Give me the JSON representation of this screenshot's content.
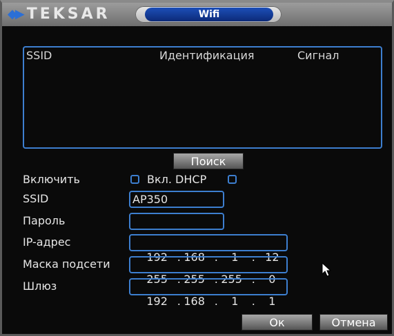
{
  "header": {
    "logo_text": "TEKSAR",
    "logo_symbol": "◆▶",
    "tab_title": "Wifi"
  },
  "network_list": {
    "columns": [
      "SSID",
      "Идентификация",
      "Сигнал"
    ],
    "rows": []
  },
  "search_button": "Поиск",
  "form": {
    "enable_label": "Включить",
    "dhcp_label": "Вкл. DHCP",
    "enable_checked": false,
    "dhcp_checked": false,
    "ssid_label": "SSID",
    "ssid_value": "AP350",
    "password_label": "Пароль",
    "password_value": "",
    "ip_label": "IP-адрес",
    "ip": [
      "192",
      "168",
      "1",
      "12"
    ],
    "mask_label": "Маска подсети",
    "mask": [
      "255",
      "255",
      "255",
      "0"
    ],
    "gateway_label": "Шлюз",
    "gateway": [
      "192",
      "168",
      "1",
      "1"
    ]
  },
  "footer": {
    "ok": "Ок",
    "cancel": "Отмена"
  },
  "colors": {
    "accent": "#3d7fd0",
    "title_tab": "#1d4fb8",
    "background": "#0a0a0a"
  }
}
